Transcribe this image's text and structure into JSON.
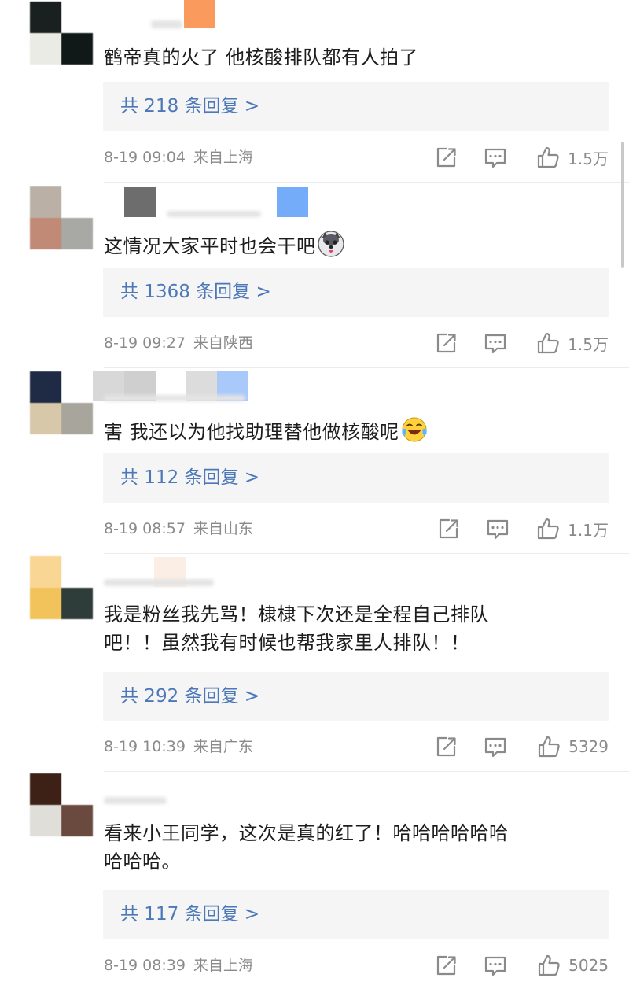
{
  "comments": [
    {
      "text": "鹤帝真的火了 他核酸排队都有人拍了",
      "replies_label": "共 218 条回复 >",
      "date": "8-19 09:04",
      "location": "来自上海",
      "likes": "1.5万",
      "avatar_colors": [
        "#1a2020",
        "#ffffff",
        "#ebebe5",
        "#111818"
      ]
    },
    {
      "text": "这情况大家平时也会干吧",
      "emoji": "husky-emoji",
      "replies_label": "共 1368 条回复 >",
      "date": "8-19 09:27",
      "location": "来自陕西",
      "likes": "1.5万",
      "avatar_colors": [
        "#bbb0a6",
        "#ffffff",
        "#c08a76",
        "#a8a8a4"
      ]
    },
    {
      "text": "害 我还以为他找助理替他做核酸呢",
      "emoji": "tears-of-joy-emoji",
      "replies_label": "共 112 条回复 >",
      "date": "8-19 08:57",
      "location": "来自山东",
      "likes": "1.1万",
      "avatar_colors": [
        "#1f2a44",
        "#ffffff",
        "#d8c8aa",
        "#a8a59c"
      ]
    },
    {
      "text_lines": [
        "我是粉丝我先骂！棣棣下次还是全程自己排队",
        "吧！！虽然我有时候也帮我家里人排队！！"
      ],
      "replies_label": "共 292 条回复 >",
      "date": "8-19 10:39",
      "location": "来自广东",
      "likes": "5329",
      "avatar_colors": [
        "#f9d693",
        "#ffffff",
        "#f2c35a",
        "#2e3d3a"
      ]
    },
    {
      "text_lines": [
        "看来小王同学，这次是真的红了！哈哈哈哈哈哈",
        "哈哈哈。"
      ],
      "replies_label": "共 117 条回复 >",
      "date": "8-19 08:39",
      "location": "来自上海",
      "likes": "5025",
      "avatar_colors": [
        "#3d2016",
        "#ffffff",
        "#e0ded9",
        "#6a4a3e"
      ]
    }
  ]
}
